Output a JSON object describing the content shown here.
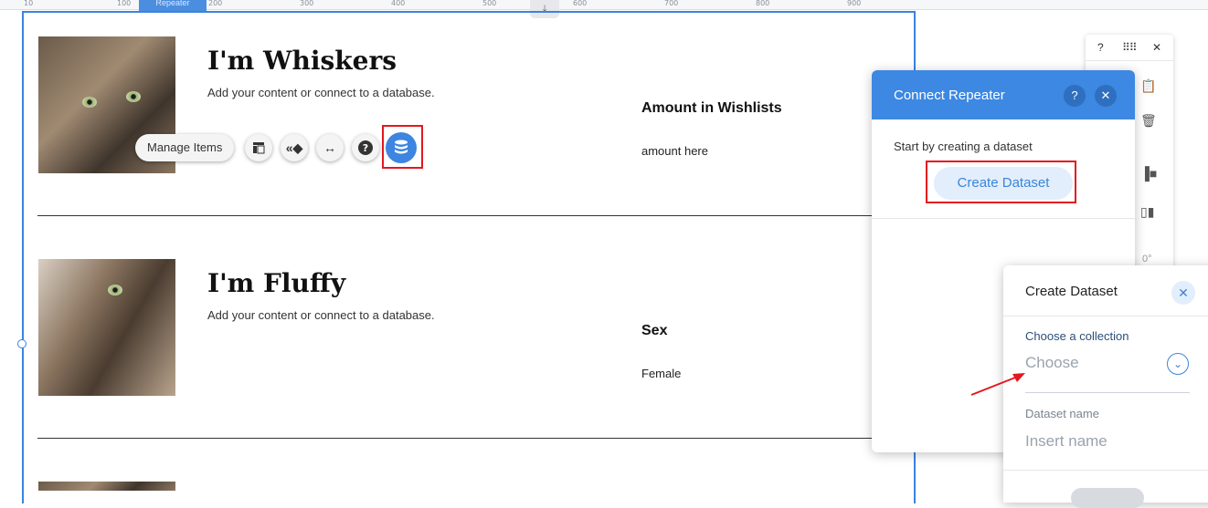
{
  "ruler": {
    "tab_label": "Repeater",
    "numbers": [
      "10",
      "100",
      "200",
      "300",
      "400",
      "500",
      "600",
      "700",
      "800",
      "900"
    ]
  },
  "items": [
    {
      "title": "I'm Whiskers",
      "description": "Add your content or connect to a database.",
      "field_label": "Amount in Wishlists",
      "field_value": "amount here"
    },
    {
      "title": "I'm Fluffy",
      "description": "Add your content or connect to a database.",
      "field_label": "Sex",
      "field_value": "Female"
    }
  ],
  "toolbar": {
    "manage_items_label": "Manage Items",
    "icons": [
      "layout-icon",
      "animation-icon",
      "stretch-icon",
      "help-icon",
      "database-icon"
    ]
  },
  "side_panel": {
    "help": "?",
    "rotation": "0°"
  },
  "connect_repeater": {
    "title": "Connect Repeater",
    "help": "?",
    "close": "✕",
    "subtitle": "Start by creating a dataset",
    "create_button": "Create Dataset"
  },
  "create_dataset": {
    "title": "Create Dataset",
    "collection_label": "Choose a collection",
    "collection_placeholder": "Choose",
    "name_label": "Dataset name",
    "name_placeholder": "Insert name"
  },
  "colors": {
    "accent": "#3c88e2",
    "highlight": "#e3171f",
    "selection": "#3b82e0"
  }
}
